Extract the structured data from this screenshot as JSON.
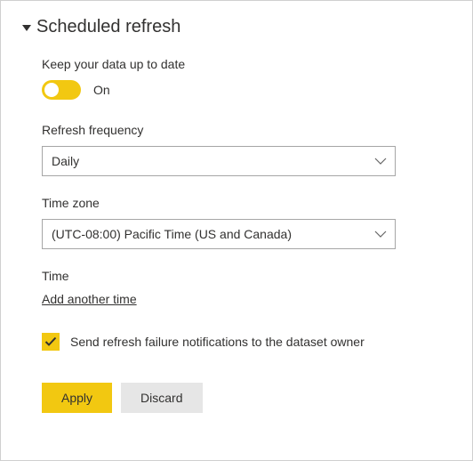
{
  "section": {
    "title": "Scheduled refresh"
  },
  "keepUpToDate": {
    "label": "Keep your data up to date",
    "stateLabel": "On"
  },
  "frequency": {
    "label": "Refresh frequency",
    "value": "Daily"
  },
  "timezone": {
    "label": "Time zone",
    "value": "(UTC-08:00) Pacific Time (US and Canada)"
  },
  "time": {
    "label": "Time",
    "addLink": "Add another time"
  },
  "notify": {
    "label": "Send refresh failure notifications to the dataset owner"
  },
  "buttons": {
    "apply": "Apply",
    "discard": "Discard"
  }
}
